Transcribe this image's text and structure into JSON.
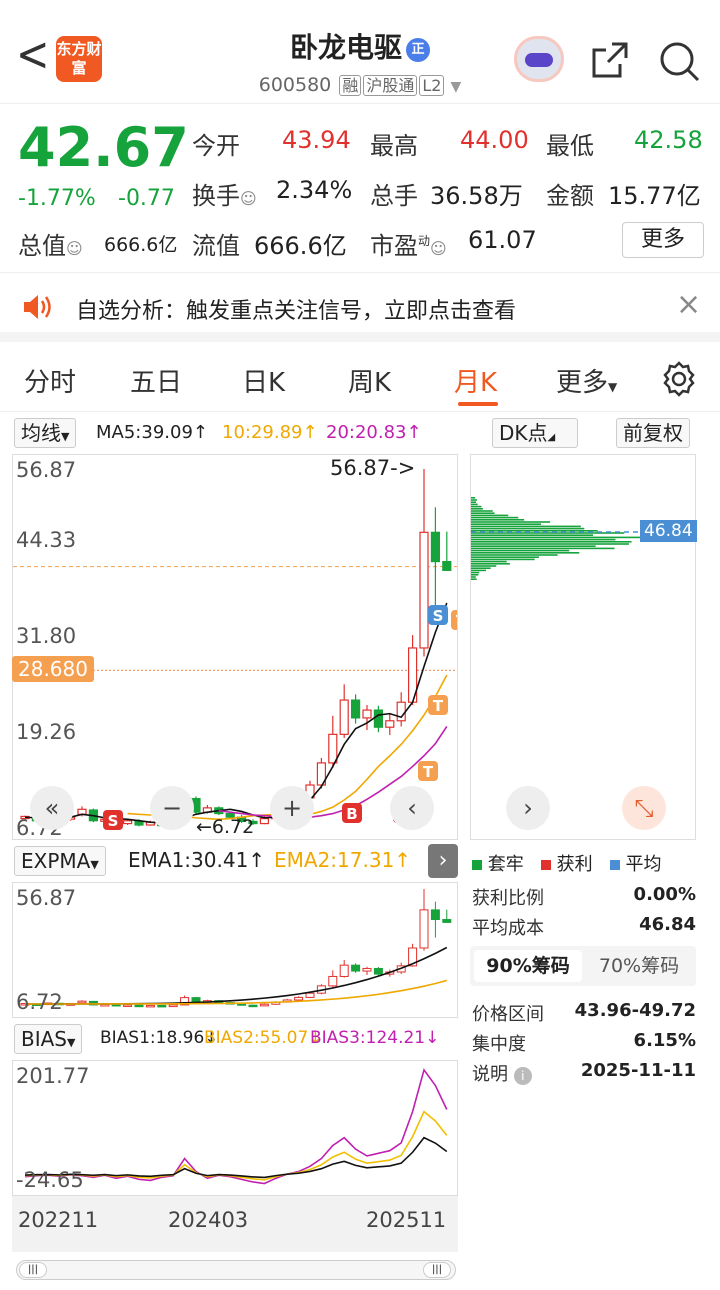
{
  "header": {
    "back": "<",
    "logo": "东方财富",
    "title": "卧龙电驱",
    "title_badge": "正",
    "code": "600580",
    "tags": [
      "融",
      "沪股通",
      "L2"
    ]
  },
  "quote": {
    "price": "42.67",
    "pct": "-1.77%",
    "chg": "-0.77",
    "open_label": "今开",
    "open": "43.94",
    "high_label": "最高",
    "high": "44.00",
    "low_label": "最低",
    "low": "42.58",
    "turn_label": "换手",
    "turn": "2.34%",
    "vol_label": "总手",
    "vol": "36.58万",
    "amt_label": "金额",
    "amt": "15.77亿",
    "mcap_label": "总值",
    "mcap": "666.6亿",
    "fmcap_label": "流值",
    "fmcap": "666.6亿",
    "pe_label": "市盈",
    "pe_sup": "动",
    "pe": "61.07",
    "more": "更多"
  },
  "alert": {
    "text": "自选分析：触发重点关注信号，立即点击查看",
    "close": "×"
  },
  "tabs": [
    "分时",
    "五日",
    "日K",
    "周K",
    "月K",
    "更多"
  ],
  "active_tab": 4,
  "ma_bar": {
    "type": "均线",
    "ma5": "MA5:39.09↑",
    "ma10": "10:29.89↑",
    "ma20": "20:20.83↑",
    "dk": "DK点",
    "adj": "前复权"
  },
  "main_chart": {
    "y_top": "56.87",
    "y2": "44.33",
    "y3": "31.80",
    "y4": "19.26",
    "y_bottom": "6.72",
    "current_price_tag": "28.680",
    "max_label": "56.87->",
    "min_label": "←6.72",
    "avg_tag": "46.84"
  },
  "expma": {
    "type": "EXPMA",
    "ema1": "EMA1:30.41↑",
    "ema2": "EMA2:17.31↑",
    "y_top": "56.87",
    "y_bottom": "6.72"
  },
  "bias": {
    "type": "BIAS",
    "b1": "BIAS1:18.96↓",
    "b2": "BIAS2:55.07↓",
    "b3": "BIAS3:124.21↓",
    "y_top": "201.77",
    "y_bottom": "-24.65"
  },
  "x_axis": [
    "202211",
    "202403",
    "202511"
  ],
  "chips": {
    "legend": [
      "套牢",
      "获利",
      "平均"
    ],
    "profit_label": "获利比例",
    "profit": "0.00%",
    "avg_label": "平均成本",
    "avg": "46.84",
    "tab90": "90%筹码",
    "tab70": "70%筹码",
    "range_label": "价格区间",
    "range": "43.96-49.72",
    "conc_label": "集中度",
    "conc": "6.15%",
    "note_label": "说明",
    "note_date": "2025-11-11"
  },
  "colors": {
    "up": "#e0312d",
    "down": "#17a33b",
    "accent": "#f05a22",
    "ma10": "#f0a800",
    "ma20": "#c020b0"
  }
}
